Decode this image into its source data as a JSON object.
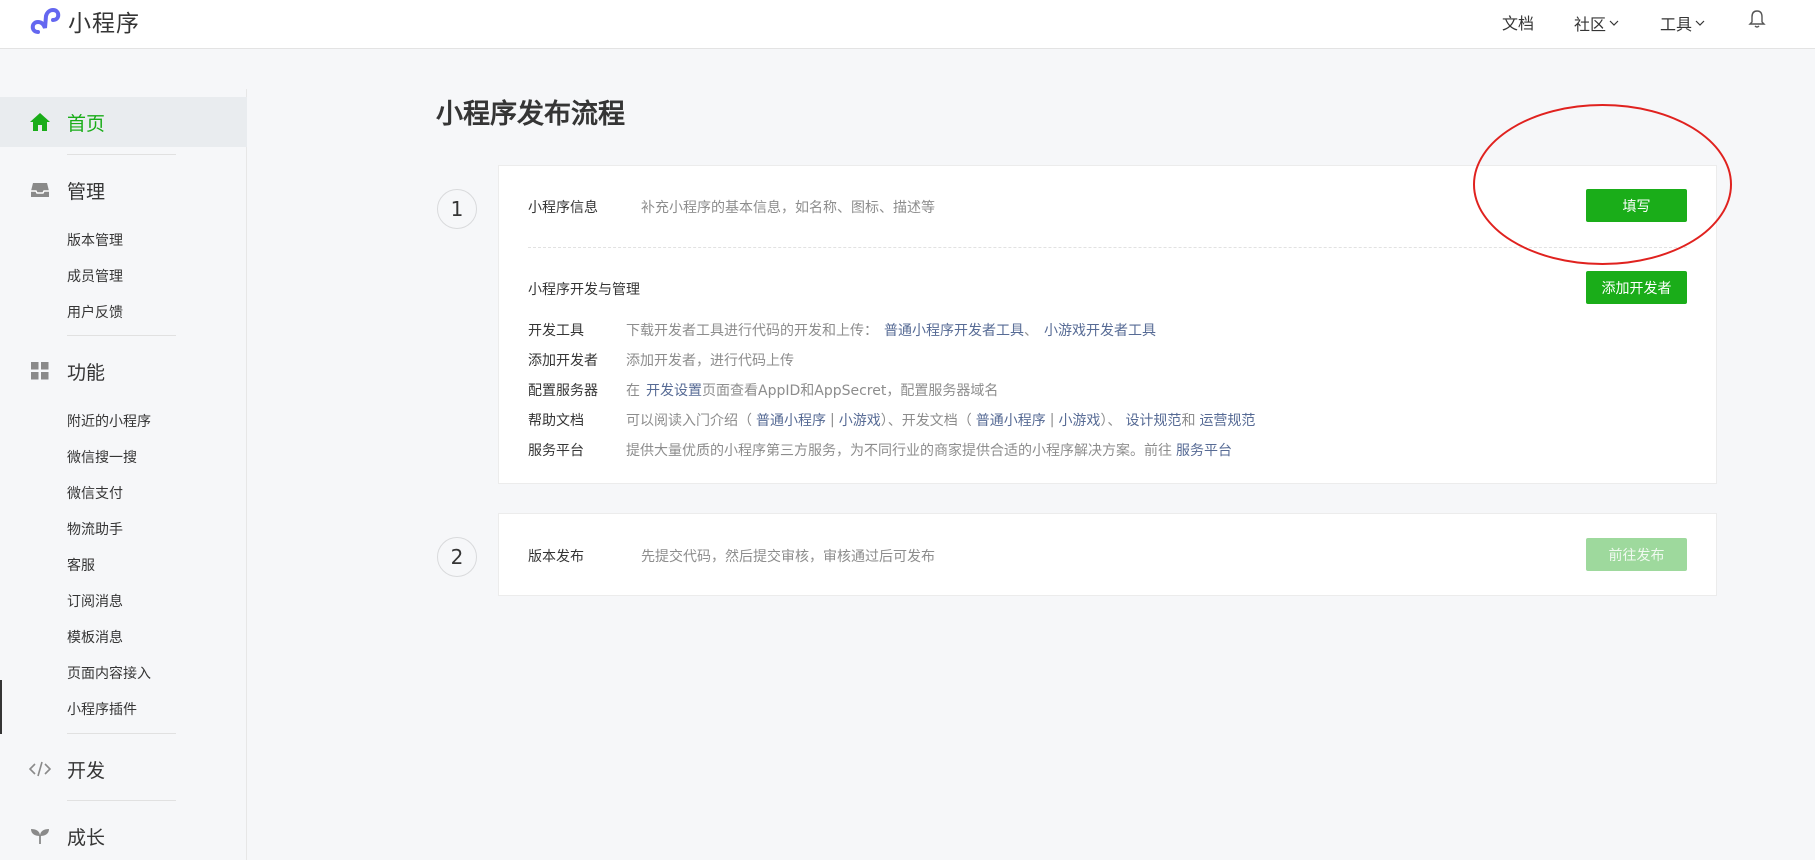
{
  "header": {
    "logo_text": "小程序",
    "nav": {
      "docs": "文档",
      "community": "社区",
      "tools": "工具"
    }
  },
  "sidebar": {
    "home": "首页",
    "manage": {
      "label": "管理",
      "items": [
        "版本管理",
        "成员管理",
        "用户反馈"
      ]
    },
    "features": {
      "label": "功能",
      "items": [
        "附近的小程序",
        "微信搜一搜",
        "微信支付",
        "物流助手",
        "客服",
        "订阅消息",
        "模板消息",
        "页面内容接入",
        "小程序插件"
      ]
    },
    "develop": "开发",
    "growth": "成长"
  },
  "main": {
    "title": "小程序发布流程",
    "step1": {
      "number": "1",
      "info_title": "小程序信息",
      "info_desc": "补充小程序的基本信息，如名称、图标、描述等",
      "info_button": "填写",
      "dev_title": "小程序开发与管理",
      "dev_button": "添加开发者",
      "details": {
        "tools_label": "开发工具",
        "tools_text": "下载开发者工具进行代码的开发和上传：",
        "tools_link1": "普通小程序开发者工具",
        "tools_sep": "、",
        "tools_link2": "小游戏开发者工具",
        "adddev_label": "添加开发者",
        "adddev_text": "添加开发者，进行代码上传",
        "server_label": "配置服务器",
        "server_text_a": "在",
        "server_link": "开发设置",
        "server_text_b": "页面查看AppID和AppSecret，配置服务器域名",
        "help_label": "帮助文档",
        "help_text_a": "可以阅读入门介绍（",
        "help_link1": "普通小程序",
        "help_bar1": "|",
        "help_link2": "小游戏",
        "help_text_b": "）、开发文档（",
        "help_link3": "普通小程序",
        "help_bar2": "|",
        "help_link4": "小游戏",
        "help_text_c": "）、",
        "help_link5": "设计规范",
        "help_text_d": "和",
        "help_link6": "运营规范",
        "service_label": "服务平台",
        "service_text": "提供大量优质的小程序第三方服务，为不同行业的商家提供合适的小程序解决方案。前往",
        "service_link": "服务平台"
      }
    },
    "step2": {
      "number": "2",
      "title": "版本发布",
      "desc": "先提交代码，然后提交审核，审核通过后可发布",
      "button": "前往发布"
    }
  },
  "colors": {
    "brand_green": "#1aad19",
    "link_blue": "#576b95",
    "annotation_red": "#e0221f"
  },
  "icons": [
    "logo-icon",
    "chevron-down-icon",
    "bell-icon",
    "home-icon",
    "inbox-icon",
    "grid-icon",
    "code-icon",
    "sprout-icon"
  ]
}
